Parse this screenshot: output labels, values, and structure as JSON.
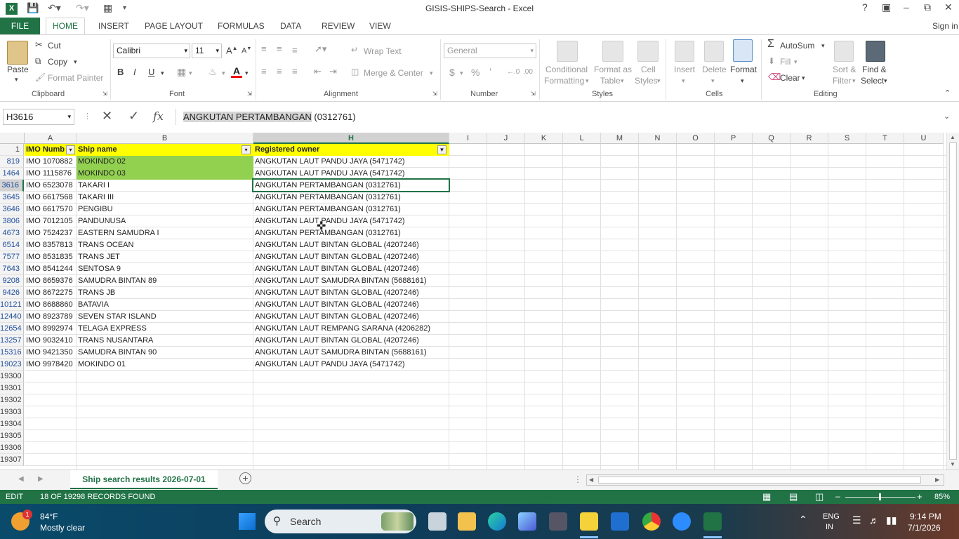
{
  "window": {
    "title": "GISIS-SHIPS-Search - Excel",
    "sign_in": "Sign in"
  },
  "tabs": [
    "FILE",
    "HOME",
    "INSERT",
    "PAGE LAYOUT",
    "FORMULAS",
    "DATA",
    "REVIEW",
    "VIEW"
  ],
  "ribbon": {
    "clipboard": {
      "paste": "Paste",
      "cut": "Cut",
      "copy": "Copy",
      "format_painter": "Format Painter",
      "group": "Clipboard"
    },
    "font": {
      "name": "Calibri",
      "size": "11",
      "bold": "B",
      "italic": "I",
      "underline": "U",
      "group": "Font"
    },
    "alignment": {
      "wrap": "Wrap Text",
      "merge": "Merge & Center",
      "group": "Alignment"
    },
    "number": {
      "format": "General",
      "dollar": "$",
      "percent": "%",
      "comma": "’",
      "group": "Number"
    },
    "styles": {
      "conditional": "Conditional",
      "conditional2": "Formatting",
      "format_as": "Format as",
      "format_as2": "Table",
      "cell": "Cell",
      "cell2": "Styles",
      "group": "Styles"
    },
    "cells": {
      "insert": "Insert",
      "delete": "Delete",
      "format": "Format",
      "group": "Cells"
    },
    "editing": {
      "autosum": "AutoSum",
      "fill": "Fill",
      "clear": "Clear",
      "sort": "Sort &",
      "sort2": "Filter",
      "find": "Find &",
      "find2": "Select",
      "group": "Editing"
    }
  },
  "formula_bar": {
    "name_box": "H3616",
    "fx": "fx",
    "content_selected": "ANGKUTAN PERTAMBANGAN",
    "content_rest": " (0312761)"
  },
  "columns": [
    "A",
    "B",
    "H",
    "I",
    "J",
    "K",
    "L",
    "M",
    "N",
    "O",
    "P",
    "Q",
    "R",
    "S",
    "T",
    "U"
  ],
  "headers": {
    "row_num": "1",
    "imo": "IMO Numb",
    "ship": "Ship name",
    "owner": "Registered owner"
  },
  "rows": [
    {
      "num": "819",
      "imo": "IMO 1070882",
      "ship": "MOKINDO 02",
      "owner": "ANGKUTAN LAUT PANDU JAYA (5471742)",
      "green": true
    },
    {
      "num": "1464",
      "imo": "IMO 1115876",
      "ship": "MOKINDO 03",
      "owner": "ANGKUTAN LAUT PANDU JAYA (5471742)",
      "green": true
    },
    {
      "num": "3616",
      "imo": "IMO 6523078",
      "ship": "TAKARI I",
      "owner": "ANGKUTAN PERTAMBANGAN (0312761)",
      "green": false
    },
    {
      "num": "3645",
      "imo": "IMO 6617568",
      "ship": "TAKARI III",
      "owner": "ANGKUTAN PERTAMBANGAN (0312761)",
      "green": false
    },
    {
      "num": "3646",
      "imo": "IMO 6617570",
      "ship": "PENGIBU",
      "owner": "ANGKUTAN PERTAMBANGAN (0312761)",
      "green": false
    },
    {
      "num": "3806",
      "imo": "IMO 7012105",
      "ship": "PANDUNUSA",
      "owner": "ANGKUTAN LAUT PANDU JAYA (5471742)",
      "green": false
    },
    {
      "num": "4673",
      "imo": "IMO 7524237",
      "ship": "EASTERN SAMUDRA I",
      "owner": "ANGKUTAN PERTAMBANGAN (0312761)",
      "green": false
    },
    {
      "num": "6514",
      "imo": "IMO 8357813",
      "ship": "TRANS OCEAN",
      "owner": "ANGKUTAN LAUT BINTAN GLOBAL (4207246)",
      "green": false
    },
    {
      "num": "7577",
      "imo": "IMO 8531835",
      "ship": "TRANS JET",
      "owner": "ANGKUTAN LAUT BINTAN GLOBAL (4207246)",
      "green": false
    },
    {
      "num": "7643",
      "imo": "IMO 8541244",
      "ship": "SENTOSA 9",
      "owner": "ANGKUTAN LAUT BINTAN GLOBAL (4207246)",
      "green": false
    },
    {
      "num": "9208",
      "imo": "IMO 8659376",
      "ship": "SAMUDRA BINTAN 89",
      "owner": "ANGKUTAN LAUT SAMUDRA BINTAN (5688161)",
      "green": false
    },
    {
      "num": "9426",
      "imo": "IMO 8672275",
      "ship": "TRANS JB",
      "owner": "ANGKUTAN LAUT BINTAN GLOBAL (4207246)",
      "green": false
    },
    {
      "num": "10121",
      "imo": "IMO 8688860",
      "ship": "BATAVIA",
      "owner": "ANGKUTAN LAUT BINTAN GLOBAL (4207246)",
      "green": false
    },
    {
      "num": "12440",
      "imo": "IMO 8923789",
      "ship": "SEVEN STAR ISLAND",
      "owner": "ANGKUTAN LAUT BINTAN GLOBAL (4207246)",
      "green": false
    },
    {
      "num": "12654",
      "imo": "IMO 8992974",
      "ship": "TELAGA EXPRESS",
      "owner": "ANGKUTAN LAUT REMPANG SARANA (4206282)",
      "green": false
    },
    {
      "num": "13257",
      "imo": "IMO 9032410",
      "ship": "TRANS NUSANTARA",
      "owner": "ANGKUTAN LAUT BINTAN GLOBAL (4207246)",
      "green": false
    },
    {
      "num": "15316",
      "imo": "IMO 9421350",
      "ship": "SAMUDRA BINTAN 90",
      "owner": "ANGKUTAN LAUT SAMUDRA BINTAN (5688161)",
      "green": false
    },
    {
      "num": "19023",
      "imo": "IMO 9978420",
      "ship": "MOKINDO 01",
      "owner": "ANGKUTAN LAUT PANDU JAYA (5471742)",
      "green": false
    }
  ],
  "empty_rows": [
    "19300",
    "19301",
    "19302",
    "19303",
    "19304",
    "19305",
    "19306",
    "19307"
  ],
  "sheet_tab": "Ship search results 2026-07-01",
  "status": {
    "mode": "EDIT",
    "message": "18 OF 19298 RECORDS FOUND",
    "zoom": "85%"
  },
  "taskbar": {
    "weather_temp": "84°F",
    "weather_desc": "Mostly clear",
    "weather_badge": "1",
    "search": "Search",
    "lang": "ENG",
    "lang2": "IN",
    "time": "9:14 PM",
    "date": "7/1/2026"
  },
  "colors": {
    "excel_green": "#217346",
    "header_yellow": "#ffff00",
    "highlight_green": "#92d050"
  }
}
